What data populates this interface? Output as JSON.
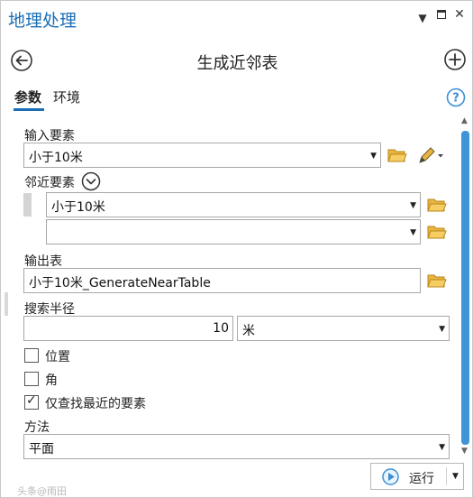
{
  "window": {
    "title": "地理处理",
    "menu_glyph": "▼",
    "close_glyph": "✕"
  },
  "tool": {
    "title": "生成近邻表"
  },
  "tabs": [
    {
      "label": "参数",
      "active": true
    },
    {
      "label": "环境",
      "active": false
    }
  ],
  "params": {
    "input_features": {
      "label": "输入要素",
      "value": "小于10米"
    },
    "near_features": {
      "label": "邻近要素",
      "items": [
        "小于10米",
        ""
      ]
    },
    "output_table": {
      "label": "输出表",
      "value": "小于10米_GenerateNearTable"
    },
    "search_radius": {
      "label": "搜索半径",
      "value": "10",
      "unit": "米"
    },
    "location": {
      "label": "位置",
      "checked": false
    },
    "angle": {
      "label": "角",
      "checked": false
    },
    "closest_only": {
      "label": "仅查找最近的要素",
      "checked": true
    },
    "method": {
      "label": "方法",
      "value": "平面"
    }
  },
  "run": {
    "label": "运行"
  },
  "watermark": "头条@雨田",
  "colors": {
    "accent": "#1a6fb6",
    "scrollbar": "#3d94d7",
    "folder": "#e0a92a",
    "run_icon": "#3c8fd5"
  },
  "icons": {
    "back": "arrow-left-circle",
    "add": "plus-circle",
    "help": "question-circle",
    "folder": "open-folder",
    "pencil": "pencil-dropdown",
    "expand": "chevron-down-circle",
    "run": "play-circle"
  }
}
